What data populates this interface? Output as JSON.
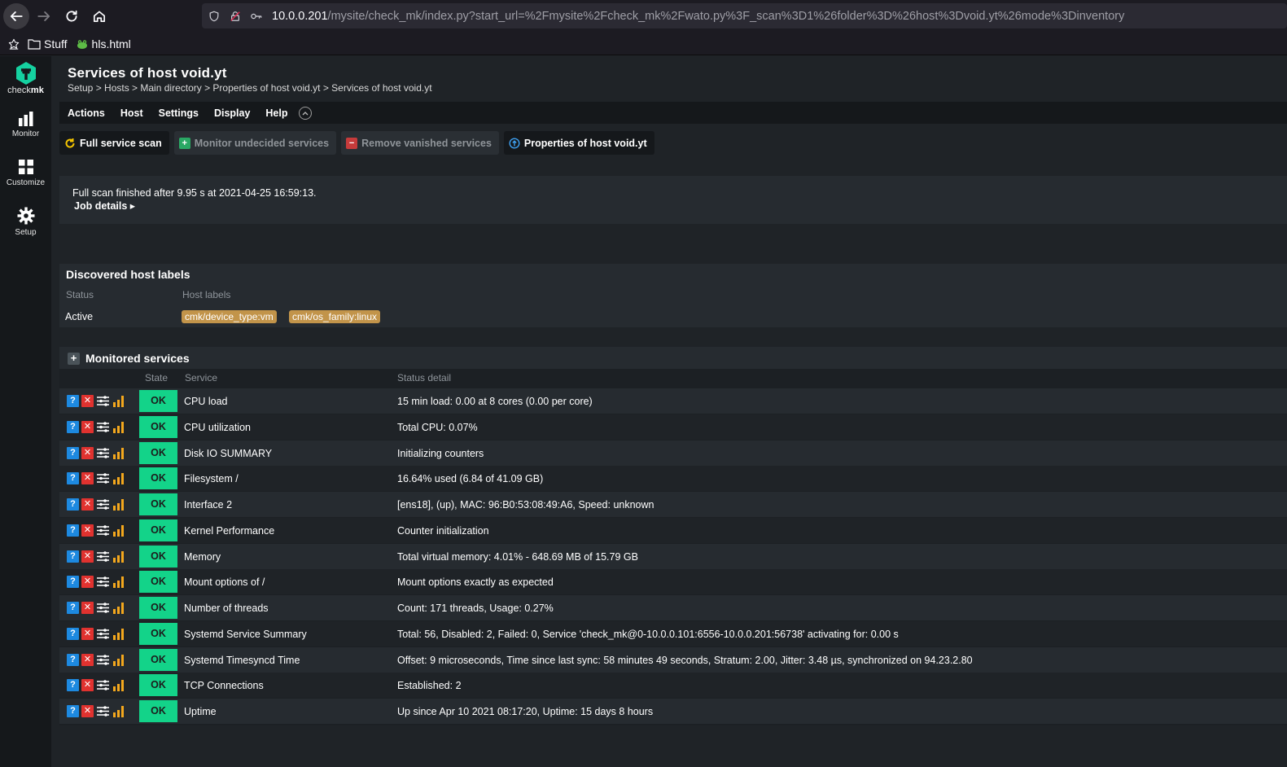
{
  "browser": {
    "url_host": "10.0.0.201",
    "url_path": "/mysite/check_mk/index.py?start_url=%2Fmysite%2Fcheck_mk%2Fwato.py%3F_scan%3D1%26folder%3D%26host%3Dvoid.yt%26mode%3Dinventory",
    "bookmarks": [
      "Stuff",
      "hls.html"
    ]
  },
  "sidebar": {
    "brand_prefix": "check",
    "brand_suffix": "mk",
    "items": [
      {
        "label": "Monitor",
        "icon": "bar-chart-icon"
      },
      {
        "label": "Customize",
        "icon": "grid-icon"
      },
      {
        "label": "Setup",
        "icon": "gear-icon"
      }
    ]
  },
  "header": {
    "title": "Services of host void.yt",
    "breadcrumb": "Setup > Hosts > Main directory > Properties of host void.yt > Services of host void.yt"
  },
  "menu": [
    "Actions",
    "Host",
    "Settings",
    "Display",
    "Help"
  ],
  "buttons": {
    "full_scan": "Full service scan",
    "monitor_undecided": "Monitor undecided services",
    "remove_vanished": "Remove vanished services",
    "properties": "Properties of host void.yt"
  },
  "info": {
    "message": "Full scan finished after 9.95 s at 2021-04-25 16:59:13.",
    "job_details": "Job details ▸"
  },
  "host_labels": {
    "title": "Discovered host labels",
    "col_status": "Status",
    "col_labels": "Host labels",
    "status": "Active",
    "labels": [
      "cmk/device_type:vm",
      "cmk/os_family:linux"
    ]
  },
  "services": {
    "title": "Monitored services",
    "col_state": "State",
    "col_service": "Service",
    "col_detail": "Status detail",
    "state_ok_color": "#13d389",
    "rows": [
      {
        "state": "OK",
        "name": "CPU load",
        "detail": "15 min load: 0.00 at 8 cores (0.00 per core)"
      },
      {
        "state": "OK",
        "name": "CPU utilization",
        "detail": "Total CPU: 0.07%"
      },
      {
        "state": "OK",
        "name": "Disk IO SUMMARY",
        "detail": "Initializing counters"
      },
      {
        "state": "OK",
        "name": "Filesystem /",
        "detail": "16.64% used (6.84 of 41.09 GB)"
      },
      {
        "state": "OK",
        "name": "Interface 2",
        "detail": "[ens18], (up), MAC: 96:B0:53:08:49:A6, Speed: unknown"
      },
      {
        "state": "OK",
        "name": "Kernel Performance",
        "detail": "Counter initialization"
      },
      {
        "state": "OK",
        "name": "Memory",
        "detail": "Total virtual memory: 4.01% - 648.69 MB of 15.79 GB"
      },
      {
        "state": "OK",
        "name": "Mount options of /",
        "detail": "Mount options exactly as expected"
      },
      {
        "state": "OK",
        "name": "Number of threads",
        "detail": "Count: 171 threads, Usage: 0.27%"
      },
      {
        "state": "OK",
        "name": "Systemd Service Summary",
        "detail": "Total: 56, Disabled: 2, Failed: 0, Service 'check_mk@0-10.0.0.101:6556-10.0.0.201:56738' activating for: 0.00 s"
      },
      {
        "state": "OK",
        "name": "Systemd Timesyncd Time",
        "detail": "Offset: 9 microseconds, Time since last sync: 58 minutes 49 seconds, Stratum: 2.00, Jitter: 3.48 µs, synchronized on 94.23.2.80"
      },
      {
        "state": "OK",
        "name": "TCP Connections",
        "detail": "Established: 2"
      },
      {
        "state": "OK",
        "name": "Uptime",
        "detail": "Up since Apr 10 2021 08:17:20, Uptime: 15 days 8 hours"
      }
    ]
  }
}
